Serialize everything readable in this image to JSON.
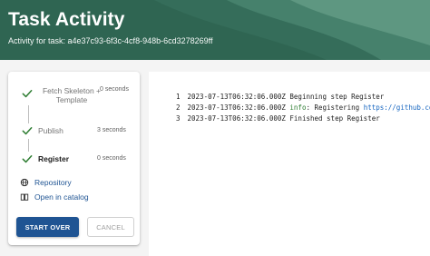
{
  "header": {
    "title": "Task Activity",
    "subtitle": "Activity for task: a4e37c93-6f3c-4cf8-948b-6cd3278269ff"
  },
  "steps": [
    {
      "label": "Fetch Skeleton + Template",
      "time": "0 seconds",
      "status": "completed"
    },
    {
      "label": "Publish",
      "time": "3 seconds",
      "status": "completed"
    },
    {
      "label": "Register",
      "time": "0 seconds",
      "status": "completed-active"
    }
  ],
  "links": {
    "repository": "Repository",
    "catalog": "Open in catalog"
  },
  "buttons": {
    "start_over": "START OVER",
    "cancel": "CANCEL"
  },
  "log": [
    {
      "num": "1",
      "timestamp": "2023-07-13T06:32:06.000Z",
      "level": "",
      "message": "Beginning step Register",
      "url": ""
    },
    {
      "num": "2",
      "timestamp": "2023-07-13T06:32:06.000Z",
      "level": "info",
      "message": ": Registering ",
      "url": "https://github.com/hen"
    },
    {
      "num": "3",
      "timestamp": "2023-07-13T06:32:06.000Z",
      "level": "",
      "message": "Finished step Register",
      "url": ""
    }
  ],
  "colors": {
    "header_bg": "#2f6552",
    "primary": "#1f5493",
    "check": "#2e7d32",
    "info": "#2e7d32",
    "link": "#1565c0"
  }
}
